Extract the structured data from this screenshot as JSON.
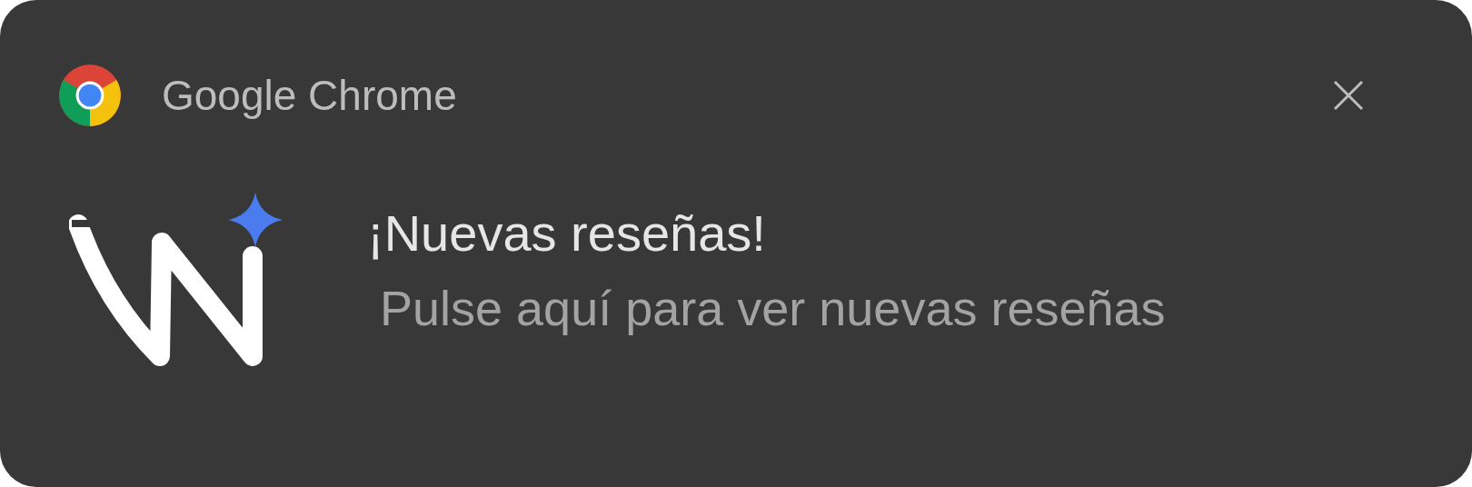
{
  "notification": {
    "app_name": "Google Chrome",
    "title": "¡Nuevas reseñas!",
    "message": "Pulse aquí para ver nuevas reseñas"
  }
}
